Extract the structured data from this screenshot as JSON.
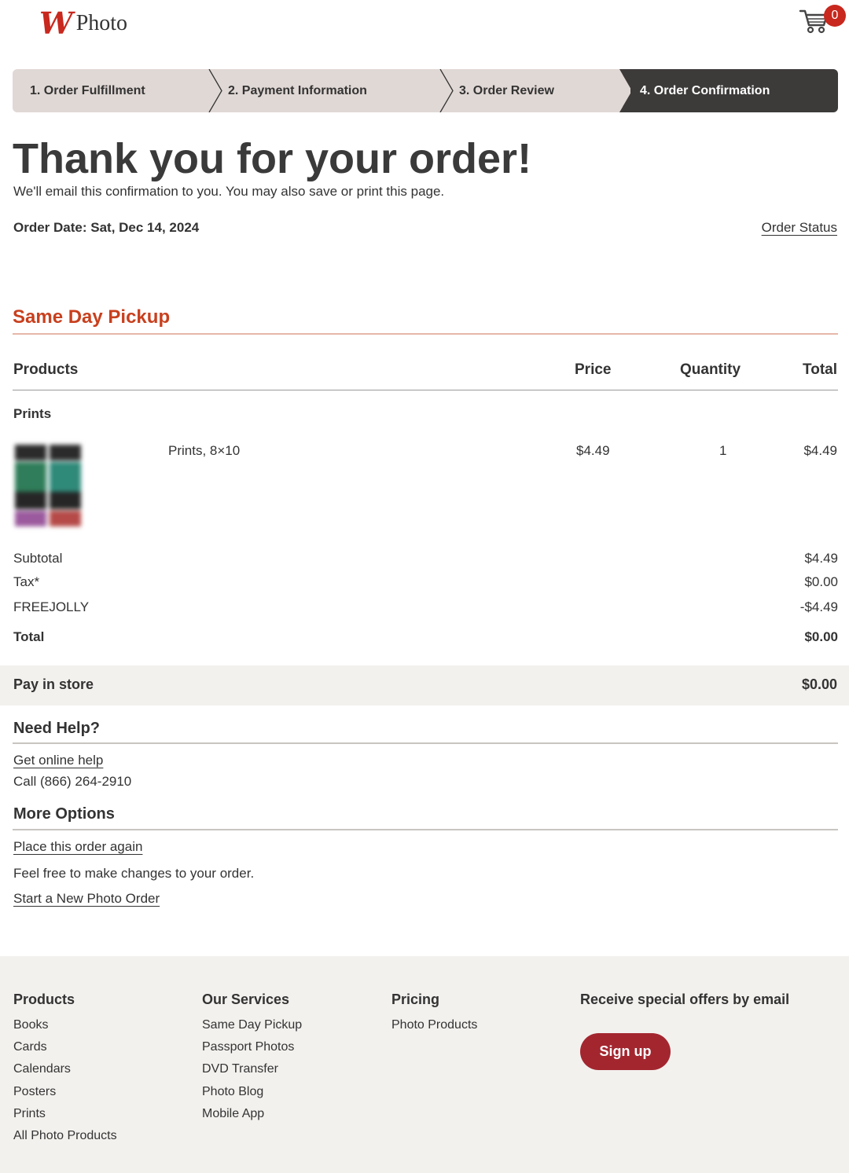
{
  "header": {
    "logo_mark": "W",
    "logo_text": "Photo",
    "cart_count": "0"
  },
  "steps": [
    {
      "label": "1. Order Fulfillment"
    },
    {
      "label": "2. Payment Information"
    },
    {
      "label": "3. Order Review"
    },
    {
      "label": "4. Order Confirmation"
    }
  ],
  "confirmation": {
    "title": "Thank you for your order!",
    "subtitle": "We'll email this confirmation to you. You may also save or print this page.",
    "order_date": "Order Date: Sat, Dec 14, 2024",
    "order_status_link": "Order Status"
  },
  "pickup": {
    "section_title": "Same Day Pickup",
    "columns": {
      "products": "Products",
      "price": "Price",
      "quantity": "Quantity",
      "total": "Total"
    },
    "category": "Prints",
    "item": {
      "name": "Prints, 8×10",
      "price": "$4.49",
      "quantity": "1",
      "total": "$4.49"
    }
  },
  "summary": {
    "subtotal_label": "Subtotal",
    "subtotal_value": "$4.49",
    "tax_label": "Tax*",
    "tax_value": "$0.00",
    "promo_label": "FREEJOLLY",
    "promo_value": "-$4.49",
    "total_label": "Total",
    "total_value": "$0.00"
  },
  "payment": {
    "label": "Pay in store",
    "value": "$0.00"
  },
  "help": {
    "title": "Need Help?",
    "online_help": "Get online help",
    "phone": "Call (866) 264-2910"
  },
  "more_options": {
    "title": "More Options",
    "place_again": "Place this order again",
    "note": "Feel free to make changes to your order.",
    "new_order": "Start a New Photo Order"
  },
  "footer": {
    "products": {
      "title": "Products",
      "items": [
        "Books",
        "Cards",
        "Calendars",
        "Posters",
        "Prints",
        "All Photo Products"
      ]
    },
    "services": {
      "title": "Our Services",
      "items": [
        "Same Day Pickup",
        "Passport Photos",
        "DVD Transfer",
        "Photo Blog",
        "Mobile App"
      ]
    },
    "pricing": {
      "title": "Pricing",
      "items": [
        "Photo Products"
      ]
    },
    "email": {
      "title": "Receive special offers by email",
      "button": "Sign up"
    }
  },
  "colors": {
    "brand_red": "#c8281e",
    "section_orange": "#c8401e",
    "active_step": "#3d3b3a",
    "inactive_step": "#e0d8d5",
    "signup_button": "#a3262f"
  }
}
